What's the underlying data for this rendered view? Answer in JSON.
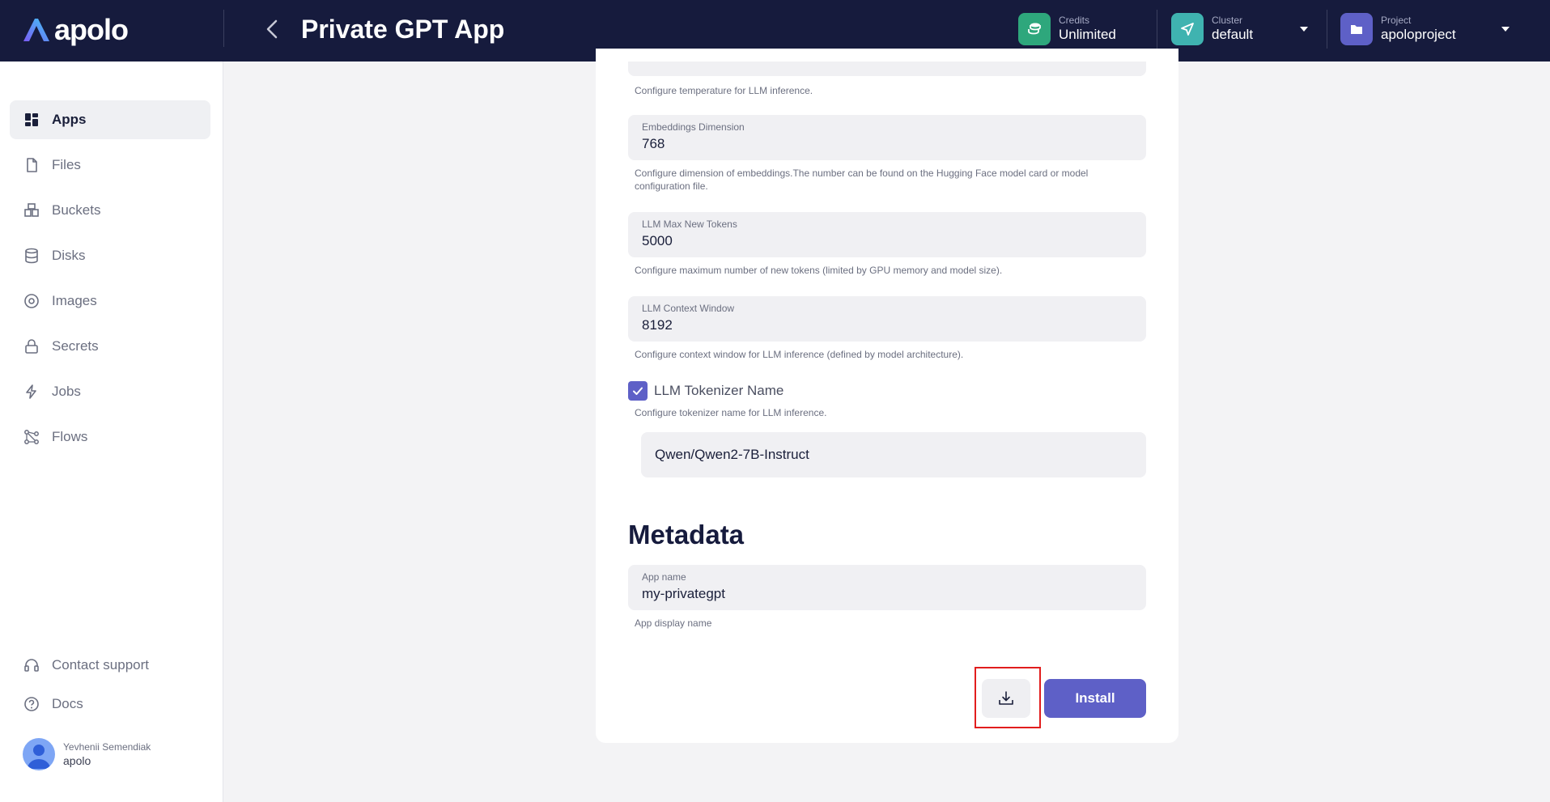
{
  "header": {
    "logo_text": "apolo",
    "title": "Private GPT App",
    "credits": {
      "label": "Credits",
      "value": "Unlimited"
    },
    "cluster": {
      "label": "Cluster",
      "value": "default"
    },
    "project": {
      "label": "Project",
      "value": "apoloproject"
    }
  },
  "sidebar": {
    "items": [
      {
        "label": "Apps",
        "icon": "apps-icon",
        "active": true
      },
      {
        "label": "Files",
        "icon": "file-icon"
      },
      {
        "label": "Buckets",
        "icon": "buckets-icon"
      },
      {
        "label": "Disks",
        "icon": "database-icon"
      },
      {
        "label": "Images",
        "icon": "disc-icon"
      },
      {
        "label": "Secrets",
        "icon": "lock-icon"
      },
      {
        "label": "Jobs",
        "icon": "lightning-icon"
      },
      {
        "label": "Flows",
        "icon": "flow-icon"
      }
    ],
    "footer": [
      {
        "label": "Contact support",
        "icon": "headset-icon"
      },
      {
        "label": "Docs",
        "icon": "help-icon"
      }
    ],
    "user": {
      "name": "Yevhenii Semendiak",
      "org": "apolo"
    }
  },
  "form": {
    "temperature_help": "Configure temperature for LLM inference.",
    "embeddings": {
      "label": "Embeddings Dimension",
      "value": "768",
      "help": "Configure dimension of embeddings.The number can be found on the Hugging Face model card or model configuration file."
    },
    "max_tokens": {
      "label": "LLM Max New Tokens",
      "value": "5000",
      "help": "Configure maximum number of new tokens (limited by GPU memory and model size)."
    },
    "context_window": {
      "label": "LLM Context Window",
      "value": "8192",
      "help": "Configure context window for LLM inference (defined by model architecture)."
    },
    "tokenizer": {
      "label": "LLM Tokenizer Name",
      "checked": true,
      "help": "Configure tokenizer name for LLM inference.",
      "value": "Qwen/Qwen2-7B-Instruct"
    },
    "metadata": {
      "title": "Metadata",
      "app_name": {
        "label": "App name",
        "value": "my-privategpt",
        "help": "App display name"
      }
    },
    "install_label": "Install"
  },
  "colors": {
    "header_bg": "#161b3d",
    "accent": "#5e60c7",
    "credits_icon": "#2ea77c",
    "cluster_icon": "#3fb3b0",
    "highlight": "#e11d1d"
  }
}
